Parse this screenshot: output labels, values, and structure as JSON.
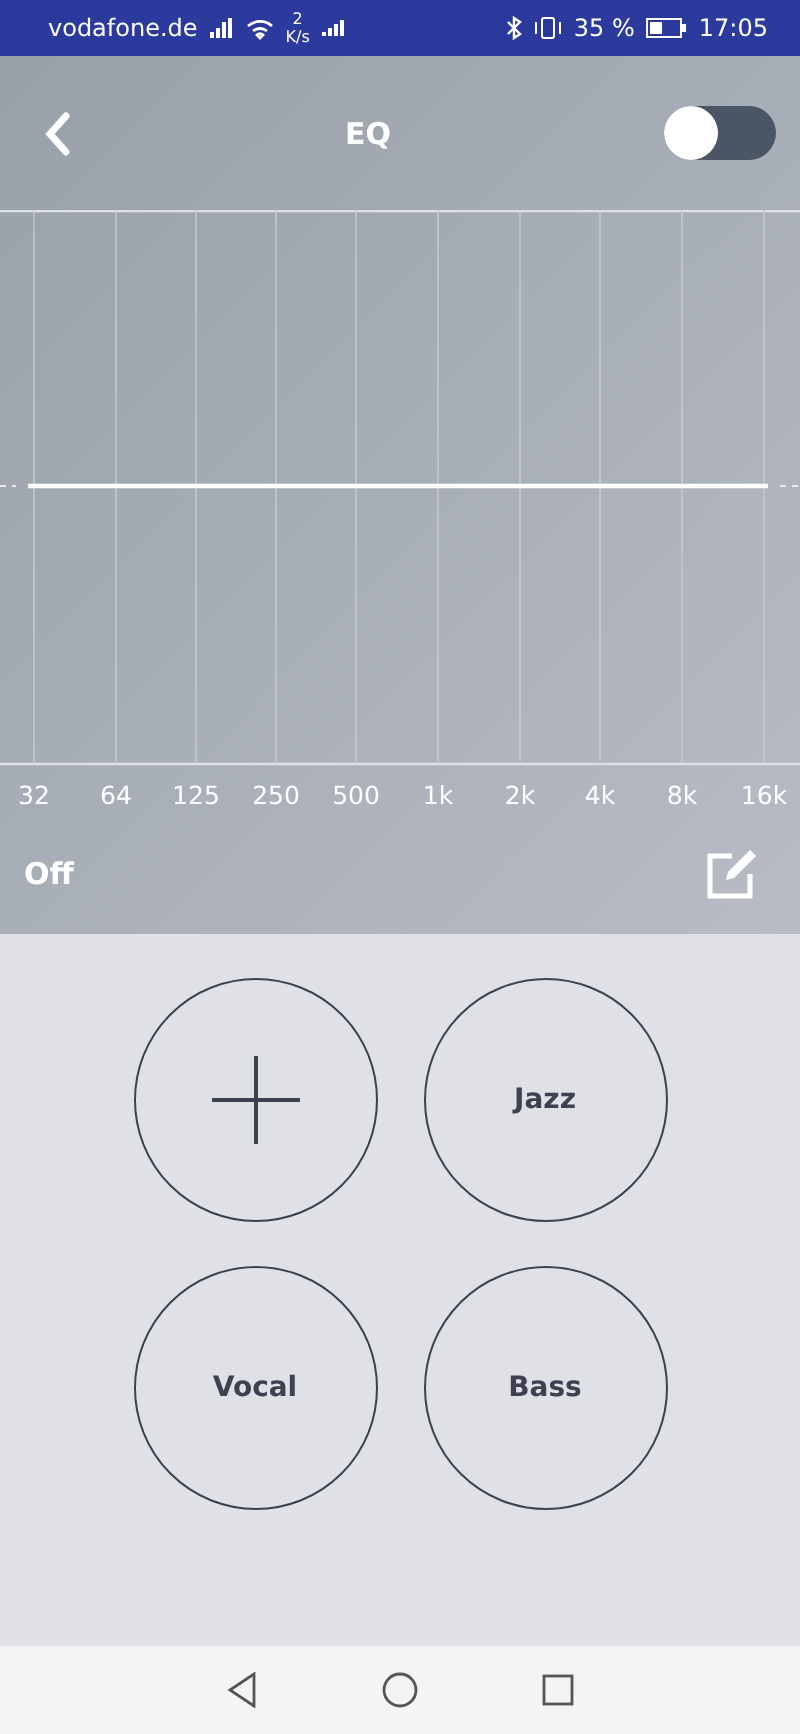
{
  "status_bar": {
    "carrier": "vodafone.de",
    "speed_value": "2",
    "speed_unit": "K/s",
    "battery": "35 %",
    "time": "17:05"
  },
  "header": {
    "title": "EQ",
    "toggle": {
      "on": false
    }
  },
  "bands": [
    "32",
    "64",
    "125",
    "250",
    "500",
    "1k",
    "2k",
    "4k",
    "8k",
    "16k"
  ],
  "preset_label": "Off",
  "presets": [
    {
      "kind": "add"
    },
    {
      "kind": "preset",
      "label": "Jazz"
    },
    {
      "kind": "preset",
      "label": "Vocal"
    },
    {
      "kind": "preset",
      "label": "Bass"
    }
  ]
}
